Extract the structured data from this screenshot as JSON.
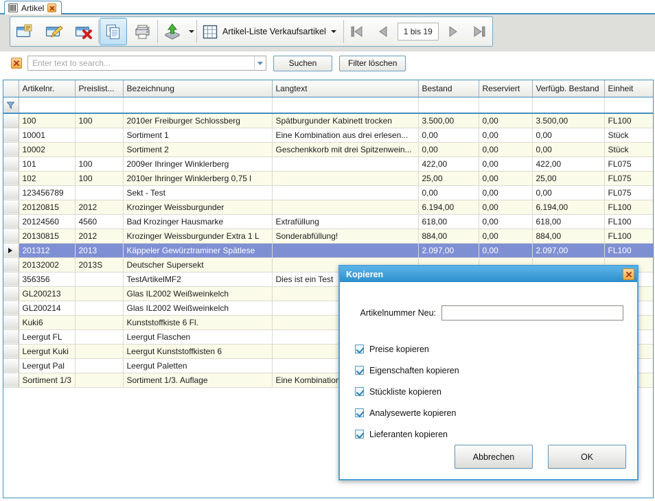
{
  "tab": {
    "label": "Artikel",
    "icon": "barcode-icon",
    "close_icon": "close-icon"
  },
  "toolbar": {
    "buttons": [
      {
        "name": "new-article-button",
        "icon": "new-window-icon"
      },
      {
        "name": "edit-article-button",
        "icon": "edit-pencil-icon"
      },
      {
        "name": "delete-article-button",
        "icon": "delete-x-icon"
      },
      {
        "name": "copy-article-button",
        "icon": "copy-documents-icon"
      },
      {
        "name": "print-button",
        "icon": "printer-icon"
      },
      {
        "name": "export-button",
        "icon": "export-up-arrow-icon"
      }
    ],
    "list_selector": {
      "icon": "grid-table-icon",
      "label": "Artikel-Liste Verkaufsartikel"
    },
    "pager": {
      "first_icon": "first-page-icon",
      "prev_icon": "previous-page-icon",
      "range_text": "1 bis 19",
      "next_icon": "next-page-icon",
      "last_icon": "last-page-icon"
    }
  },
  "search": {
    "clear_icon": "clear-filter-icon",
    "placeholder": "Enter text to search...",
    "value": "",
    "dropdown_icon": "chevron-down-icon",
    "search_button": "Suchen",
    "clear_filter_button": "Filter löschen"
  },
  "grid": {
    "columns": [
      {
        "key": "artikelnr",
        "label": "Artikelnr.",
        "sorted": "asc"
      },
      {
        "key": "preisliste",
        "label": "Preislist..."
      },
      {
        "key": "bezeichnung",
        "label": "Bezeichnung"
      },
      {
        "key": "langtext",
        "label": "Langtext"
      },
      {
        "key": "bestand",
        "label": "Bestand"
      },
      {
        "key": "reserviert",
        "label": "Reserviert"
      },
      {
        "key": "verfuegbar",
        "label": "Verfügb. Bestand"
      },
      {
        "key": "einheit",
        "label": "Einheit"
      }
    ],
    "filter_icon": "funnel-icon",
    "rows": [
      {
        "artikelnr": "100",
        "preisliste": "100",
        "bezeichnung": "2010er Freiburger Schlossberg",
        "langtext": "Spätburgunder Kabinett trocken",
        "bestand": "3.500,00",
        "reserviert": "0,00",
        "verfuegbar": "3.500,00",
        "einheit": "FL100",
        "selected": false
      },
      {
        "artikelnr": "10001",
        "preisliste": "",
        "bezeichnung": "Sortiment 1",
        "langtext": "Eine Kombination aus drei erlesen...",
        "bestand": "0,00",
        "reserviert": "0,00",
        "verfuegbar": "0,00",
        "einheit": "Stück",
        "selected": false
      },
      {
        "artikelnr": "10002",
        "preisliste": "",
        "bezeichnung": "Sortiment 2",
        "langtext": "Geschenkkorb mit drei Spitzenwein...",
        "bestand": "0,00",
        "reserviert": "0,00",
        "verfuegbar": "0,00",
        "einheit": "Stück",
        "selected": false
      },
      {
        "artikelnr": "101",
        "preisliste": "100",
        "bezeichnung": "2009er Ihringer Winklerberg",
        "langtext": "",
        "bestand": "422,00",
        "reserviert": "0,00",
        "verfuegbar": "422,00",
        "einheit": "FL075",
        "selected": false
      },
      {
        "artikelnr": "102",
        "preisliste": "100",
        "bezeichnung": "2010er Ihringer Winklerberg 0,75 l",
        "langtext": "",
        "bestand": "25,00",
        "reserviert": "0,00",
        "verfuegbar": "25,00",
        "einheit": "FL075",
        "selected": false
      },
      {
        "artikelnr": "123456789",
        "preisliste": "",
        "bezeichnung": "Sekt - Test",
        "langtext": "",
        "bestand": "0,00",
        "reserviert": "0,00",
        "verfuegbar": "0,00",
        "einheit": "FL075",
        "selected": false
      },
      {
        "artikelnr": "20120815",
        "preisliste": "2012",
        "bezeichnung": "Krozinger Weissburgunder",
        "langtext": "",
        "bestand": "6.194,00",
        "reserviert": "0,00",
        "verfuegbar": "6.194,00",
        "einheit": "FL100",
        "selected": false
      },
      {
        "artikelnr": "20124560",
        "preisliste": "4560",
        "bezeichnung": "Bad Krozinger Hausmarke",
        "langtext": "Extrafüllung",
        "bestand": "618,00",
        "reserviert": "0,00",
        "verfuegbar": "618,00",
        "einheit": "FL100",
        "selected": false
      },
      {
        "artikelnr": "20130815",
        "preisliste": "2012",
        "bezeichnung": "Krozinger Weissburgunder Extra 1 L",
        "langtext": "Sonderabfüllung!",
        "bestand": "884,00",
        "reserviert": "0,00",
        "verfuegbar": "884,00",
        "einheit": "FL100",
        "selected": false
      },
      {
        "artikelnr": "201312",
        "preisliste": "2013",
        "bezeichnung": "Käppeler Gewürztraminer Spätlese",
        "langtext": "",
        "bestand": "2.097,00",
        "reserviert": "0,00",
        "verfuegbar": "2.097,00",
        "einheit": "FL100",
        "selected": true
      },
      {
        "artikelnr": "20132002",
        "preisliste": "2013S",
        "bezeichnung": "Deutscher Supersekt",
        "langtext": "",
        "bestand": "",
        "reserviert": "",
        "verfuegbar": "",
        "einheit": "",
        "selected": false
      },
      {
        "artikelnr": "356356",
        "preisliste": "",
        "bezeichnung": "TestArtikelMF2",
        "langtext": "Dies ist ein Test",
        "bestand": "",
        "reserviert": "",
        "verfuegbar": "",
        "einheit": "",
        "selected": false
      },
      {
        "artikelnr": "GL200213",
        "preisliste": "",
        "bezeichnung": "Glas IL2002 Weißweinkelch",
        "langtext": "",
        "bestand": "",
        "reserviert": "",
        "verfuegbar": "",
        "einheit": "",
        "selected": false
      },
      {
        "artikelnr": "GL200214",
        "preisliste": "",
        "bezeichnung": "Glas IL2002 Weißweinkelch",
        "langtext": "",
        "bestand": "",
        "reserviert": "",
        "verfuegbar": "",
        "einheit": "",
        "selected": false
      },
      {
        "artikelnr": "Kuki6",
        "preisliste": "",
        "bezeichnung": "Kunststoffkiste 6 Fl.",
        "langtext": "",
        "bestand": "",
        "reserviert": "",
        "verfuegbar": "",
        "einheit": "",
        "selected": false
      },
      {
        "artikelnr": "Leergut FL",
        "preisliste": "",
        "bezeichnung": "Leergut Flaschen",
        "langtext": "",
        "bestand": "",
        "reserviert": "",
        "verfuegbar": "",
        "einheit": "",
        "selected": false
      },
      {
        "artikelnr": "Leergut Kuki",
        "preisliste": "",
        "bezeichnung": "Leergut Kunststoffkisten 6",
        "langtext": "",
        "bestand": "",
        "reserviert": "",
        "verfuegbar": "",
        "einheit": "",
        "selected": false
      },
      {
        "artikelnr": "Leergut Pal",
        "preisliste": "",
        "bezeichnung": "Leergut Paletten",
        "langtext": "",
        "bestand": "",
        "reserviert": "",
        "verfuegbar": "",
        "einheit": "",
        "selected": false
      },
      {
        "artikelnr": "Sortiment 1/3",
        "preisliste": "",
        "bezeichnung": "Sortiment 1/3. Auflage",
        "langtext": "Eine Kombination",
        "bestand": "",
        "reserviert": "",
        "verfuegbar": "",
        "einheit": "",
        "selected": false
      }
    ]
  },
  "dialog": {
    "title": "Kopieren",
    "close_icon": "close-icon",
    "field_label": "Artikelnummer Neu:",
    "field_value": "",
    "checkboxes": [
      {
        "label": "Preise kopieren",
        "checked": true
      },
      {
        "label": "Eigenschaften kopieren",
        "checked": true
      },
      {
        "label": "Stückliste kopieren",
        "checked": true
      },
      {
        "label": "Analysewerte kopieren",
        "checked": true
      },
      {
        "label": "Lieferanten kopieren",
        "checked": true
      }
    ],
    "cancel_button": "Abbrechen",
    "ok_button": "OK"
  },
  "colors": {
    "accent": "#3f8fc0",
    "title_gradient_start": "#5cb4e8",
    "title_gradient_end": "#2d8ecb",
    "row_alt": "#fbfbe9",
    "row_selected": "#7f8fd4",
    "toolbar_bg": "#dededa"
  }
}
